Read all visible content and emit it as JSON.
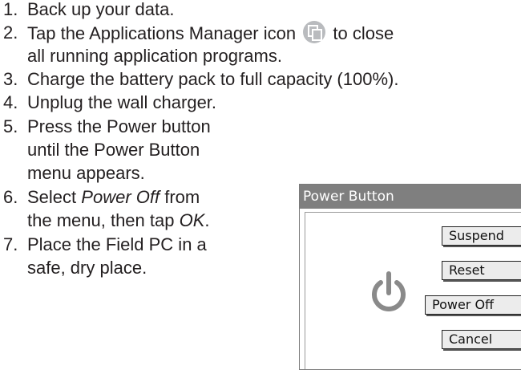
{
  "steps": [
    {
      "num": "1.",
      "lines": [
        "Back up your data."
      ]
    },
    {
      "num": "2.",
      "pre": "Tap the Applications Manager icon",
      "post": "to close",
      "line2": "all running application programs."
    },
    {
      "num": "3.",
      "lines": [
        "Charge the battery pack to full capacity (100%)."
      ]
    },
    {
      "num": "4.",
      "lines": [
        "Unplug the wall charger."
      ]
    },
    {
      "num": "5.",
      "lines": [
        "Press the Power button",
        "until the Power Button",
        "menu appears."
      ]
    },
    {
      "num": "6.",
      "pre": "Select",
      "em1": "Power Off",
      "mid": "from",
      "line2pre": "the menu, then tap",
      "em2": "OK",
      "line2post": "."
    },
    {
      "num": "7.",
      "lines": [
        "Place the Field PC in a",
        "safe, dry place."
      ]
    }
  ],
  "dialog": {
    "title": "Power Button",
    "buttons": [
      "Suspend",
      "Reset",
      "Power Off",
      "Cancel"
    ]
  },
  "icons": {
    "app_manager": "applications-manager-icon",
    "power": "power-icon"
  },
  "colors": {
    "text": "#231f20",
    "titlebar": "#7f7f7f",
    "icon": "#b9bbbe"
  }
}
